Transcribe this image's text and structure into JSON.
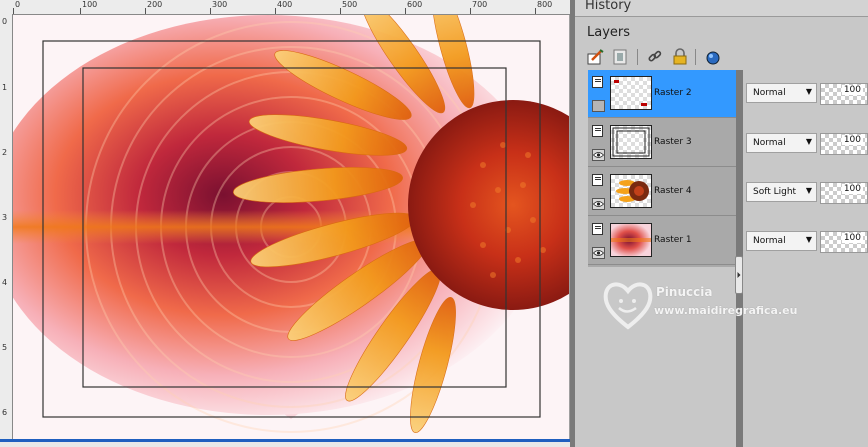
{
  "panels": {
    "history_title": "History",
    "layers_title": "Layers"
  },
  "ruler": {
    "top_labels": [
      "0",
      "100",
      "200",
      "300",
      "400",
      "500",
      "600",
      "700",
      "800"
    ],
    "left_labels": [
      "0",
      "1",
      "2",
      "3",
      "4",
      "5",
      "6"
    ]
  },
  "toolbar": {
    "icons": [
      "new-raster-layer-icon",
      "new-mask-layer-icon",
      "link-icon",
      "lock-icon",
      "layer-properties-icon"
    ]
  },
  "layers": [
    {
      "name": "Raster 2",
      "blend": "Normal",
      "opacity": "100",
      "selected": true,
      "visible": false
    },
    {
      "name": "Raster 3",
      "blend": "Normal",
      "opacity": "100",
      "selected": false,
      "visible": true
    },
    {
      "name": "Raster 4",
      "blend": "Soft Light",
      "opacity": "100",
      "selected": false,
      "visible": true
    },
    {
      "name": "Raster 1",
      "blend": "Normal",
      "opacity": "100",
      "selected": false,
      "visible": true
    }
  ],
  "watermark": {
    "name": "Pinuccia",
    "url": "www.maidiregrafica.eu"
  },
  "colors": {
    "selection": "#3399ff",
    "panel_bg": "#c8c8c8",
    "petal_orange": "#f39a1c",
    "center_red": "#c8301a"
  }
}
